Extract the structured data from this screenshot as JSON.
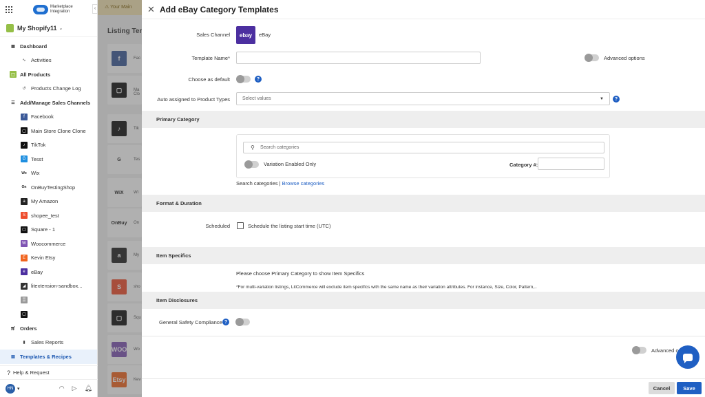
{
  "app": {
    "logo_text_line1": "Marketplace",
    "logo_text_line2": "Integration",
    "store_name": "My Shopify11"
  },
  "sidebar": {
    "items": [
      {
        "label": "Dashboard",
        "level": "head",
        "icon": "dashboard-icon"
      },
      {
        "label": "Activities",
        "level": "sub",
        "icon": "activity-icon"
      },
      {
        "label": "All Products",
        "level": "head",
        "icon": "shopify-bag-icon",
        "color": "#95bf47"
      },
      {
        "label": "Products Change Log",
        "level": "sub",
        "icon": "history-icon"
      },
      {
        "label": "Add/Manage Sales Channels",
        "level": "head",
        "icon": "list-icon"
      },
      {
        "label": "Facebook",
        "level": "sub",
        "icon": "facebook-icon",
        "color": "#3b5998"
      },
      {
        "label": "Main Store Clone Clone",
        "level": "sub",
        "icon": "square-icon",
        "color": "#111111"
      },
      {
        "label": "TikTok",
        "level": "sub",
        "icon": "tiktok-icon",
        "color": "#111111"
      },
      {
        "label": "Tesst",
        "level": "sub",
        "icon": "tesst-icon",
        "color": "#1f8fe0"
      },
      {
        "label": "Wix",
        "level": "sub",
        "icon": "wix-icon",
        "color": "#ffffff"
      },
      {
        "label": "OnBuyTestingShop",
        "level": "sub",
        "icon": "onbuy-icon",
        "color": "#ffffff"
      },
      {
        "label": "My Amazon",
        "level": "sub",
        "icon": "amazon-icon",
        "color": "#222222"
      },
      {
        "label": "shopee_test",
        "level": "sub",
        "icon": "shopee-icon",
        "color": "#ee4d2d"
      },
      {
        "label": "Square - 1",
        "level": "sub",
        "icon": "square-icon",
        "color": "#111111"
      },
      {
        "label": "Woocommerce",
        "level": "sub",
        "icon": "woocommerce-icon",
        "color": "#7f54b3"
      },
      {
        "label": "Kevin Etsy",
        "level": "sub",
        "icon": "etsy-icon",
        "color": "#f1641e"
      },
      {
        "label": "eBay",
        "level": "sub",
        "icon": "ebay-icon",
        "color": "#4c2fa0"
      },
      {
        "label": "litextension-sandbox...",
        "level": "sub",
        "icon": "litextension-icon",
        "color": "#333333"
      },
      {
        "label": "",
        "level": "sub",
        "icon": "redacted-channel-icon",
        "color": "#999999"
      },
      {
        "label": "",
        "level": "sub",
        "icon": "square-icon",
        "color": "#111111"
      },
      {
        "label": "Orders",
        "level": "head",
        "icon": "cart-icon"
      },
      {
        "label": "Sales Reports",
        "level": "sub",
        "icon": "bar-chart-icon"
      },
      {
        "label": "Templates & Recipes",
        "level": "head",
        "icon": "document-icon",
        "active": true
      }
    ],
    "help_label": "Help & Request",
    "avatar_initials": "HN"
  },
  "background": {
    "banner_text": "Your Main",
    "title": "Listing Ten",
    "cards": [
      {
        "label": "Fac",
        "icon": "facebook-icon",
        "color": "#3b5998",
        "glyph": "f"
      },
      {
        "label": "Ma Clo",
        "icon": "square-icon",
        "color": "#111111",
        "glyph": "▢"
      },
      {
        "label": "Tik",
        "icon": "tiktok-icon",
        "color": "#111111",
        "glyph": "♪"
      },
      {
        "label": "Tes",
        "icon": "tesst-icon",
        "color": "#ffffff",
        "glyph": "G"
      },
      {
        "label": "Wi",
        "icon": "wix-icon",
        "color": "#ffffff",
        "glyph": "WiX"
      },
      {
        "label": "On",
        "icon": "onbuy-icon",
        "color": "#ffffff",
        "glyph": "OnBuy"
      },
      {
        "label": "My",
        "icon": "amazon-icon",
        "color": "#222222",
        "glyph": "a"
      },
      {
        "label": "sho",
        "icon": "shopee-icon",
        "color": "#ee4d2d",
        "glyph": "S"
      },
      {
        "label": "Squ",
        "icon": "square-icon",
        "color": "#111111",
        "glyph": "▢"
      },
      {
        "label": "Wo",
        "icon": "woocommerce-icon",
        "color": "#7f54b3",
        "glyph": "WOO"
      },
      {
        "label": "Kev",
        "icon": "etsy-icon",
        "color": "#f1641e",
        "glyph": "Etsy"
      }
    ]
  },
  "panel": {
    "title": "Add eBay Category Templates",
    "sales_channel_label": "Sales Channel",
    "sales_channel_value": "eBay",
    "ebay_logo_text": "ebay",
    "template_name_label": "Template Name*",
    "template_name_value": "",
    "advanced_options_label": "Advanced options",
    "choose_default_label": "Choose as default",
    "auto_assigned_label": "Auto assigned to Product Types",
    "auto_assigned_placeholder": "Select values",
    "primary_category_title": "Primary Category",
    "search_categories_placeholder": "Search categories",
    "variation_enabled_label": "Variation Enabled Only",
    "category_number_label": "Category #:",
    "search_categories_link": "Search categories",
    "separator": "|",
    "browse_categories_link": "Browse categories",
    "format_duration_title": "Format & Duration",
    "scheduled_label": "Scheduled",
    "schedule_checkbox_label": "Schedule the listing start time (UTC)",
    "item_specifics_title": "Item Specifics",
    "item_specifics_message": "Please choose Primary Category to show Item Specifics",
    "item_specifics_note": "*For multi-variation listings, LitCommerce will exclude item specifics with the same name as their variation attributes. For instance, Size, Color, Pattern,..",
    "item_disclosures_title": "Item Disclosures",
    "safety_compliance_label": "General Safety Compliance",
    "advanced_options_bottom": "Advanced options",
    "cancel_label": "Cancel",
    "save_label": "Save"
  },
  "colors": {
    "primary": "#1f5fc3",
    "ebay": "#4c2fa0",
    "section_bg": "#eeeeee"
  }
}
